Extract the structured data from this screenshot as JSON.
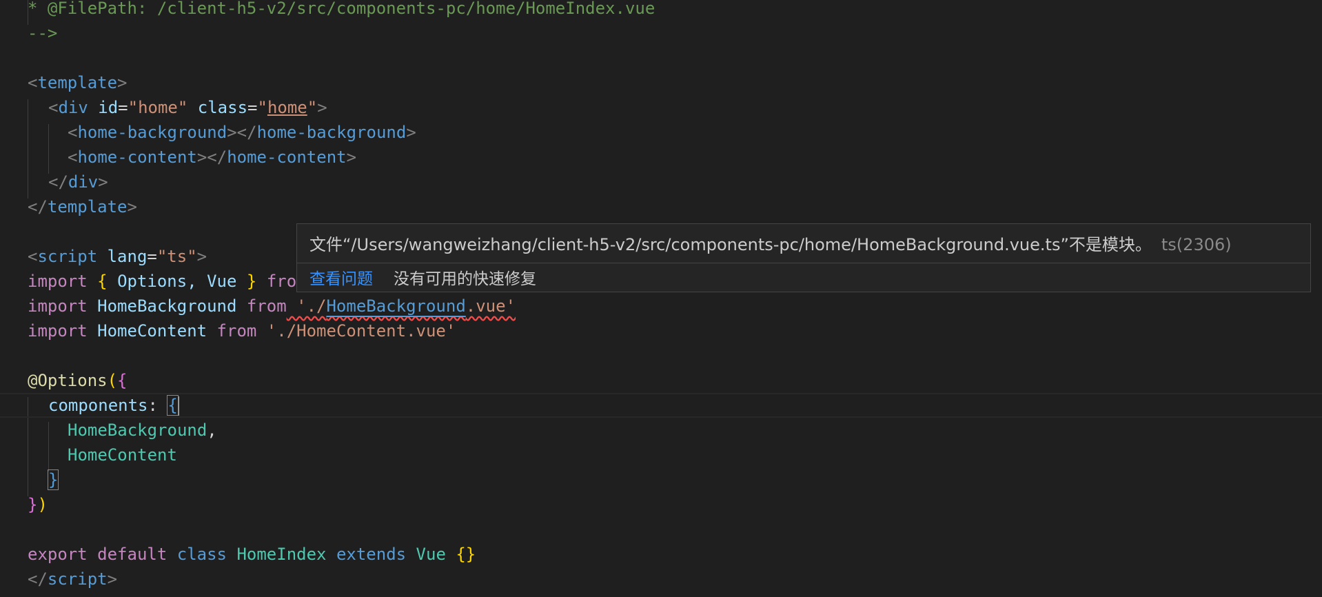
{
  "lines": {
    "l1": "* @FilePath: /client-h5-v2/src/components-pc/home/HomeIndex.vue",
    "l2": "-->",
    "l4_open": "<",
    "l4_tag": "template",
    "l4_close": ">",
    "l5_open": "<",
    "l5_tag": "div",
    "l5_attr1": " id",
    "l5_eq1": "=",
    "l5_val1": "\"home\"",
    "l5_attr2": " class",
    "l5_eq2": "=",
    "l5_q1": "\"",
    "l5_val2": "home",
    "l5_q2": "\"",
    "l5_close": ">",
    "l6_o1": "<",
    "l6_tag1": "home-background",
    "l6_c1": "></",
    "l6_tag2": "home-background",
    "l6_c2": ">",
    "l7_o1": "<",
    "l7_tag1": "home-content",
    "l7_c1": "></",
    "l7_tag2": "home-content",
    "l7_c2": ">",
    "l8_open": "</",
    "l8_tag": "div",
    "l8_close": ">",
    "l9_open": "</",
    "l9_tag": "template",
    "l9_close": ">",
    "l11_open": "<",
    "l11_tag": "script",
    "l11_attr": " lang",
    "l11_eq": "=",
    "l11_val": "\"ts\"",
    "l11_close": ">",
    "l12_kw": "import",
    "l12_b1": " { ",
    "l12_names": "Options, Vue",
    "l12_b2": " } ",
    "l12_from": "fro",
    "l13_kw": "import",
    "l13_name": " HomeBackground ",
    "l13_from": "from",
    "l13_q1": " './",
    "l13_link": "HomeBackground",
    "l13_ext": ".vue'",
    "l14_kw": "import",
    "l14_name": " HomeContent ",
    "l14_from": "from",
    "l14_str": " './HomeContent.vue'",
    "l16_deco": "@Options",
    "l16_p": "(",
    "l16_b": "{",
    "l17_key": "components",
    "l17_colon": ": ",
    "l17_b": "{",
    "l18_item": "HomeBackground",
    "l18_comma": ",",
    "l19_item": "HomeContent",
    "l20_b": "}",
    "l21_b": "}",
    "l21_p": ")",
    "l23_kw1": "export",
    "l23_kw2": " default",
    "l23_kw3": " class",
    "l23_name": " HomeIndex",
    "l23_kw4": " extends",
    "l23_base": " Vue",
    "l23_body": " {}",
    "l24_open": "</",
    "l24_tag": "script",
    "l24_close": ">"
  },
  "hover": {
    "message": "文件“/Users/wangweizhang/client-h5-v2/src/components-pc/home/HomeBackground.vue.ts”不是模块。",
    "code": "ts(2306)",
    "view_problem": "查看问题",
    "no_quick_fix": "没有可用的快速修复"
  },
  "colors": {
    "background": "#1f1f1f",
    "hover_bg": "#252526",
    "link": "#3794ff",
    "error": "#f14c4c"
  }
}
